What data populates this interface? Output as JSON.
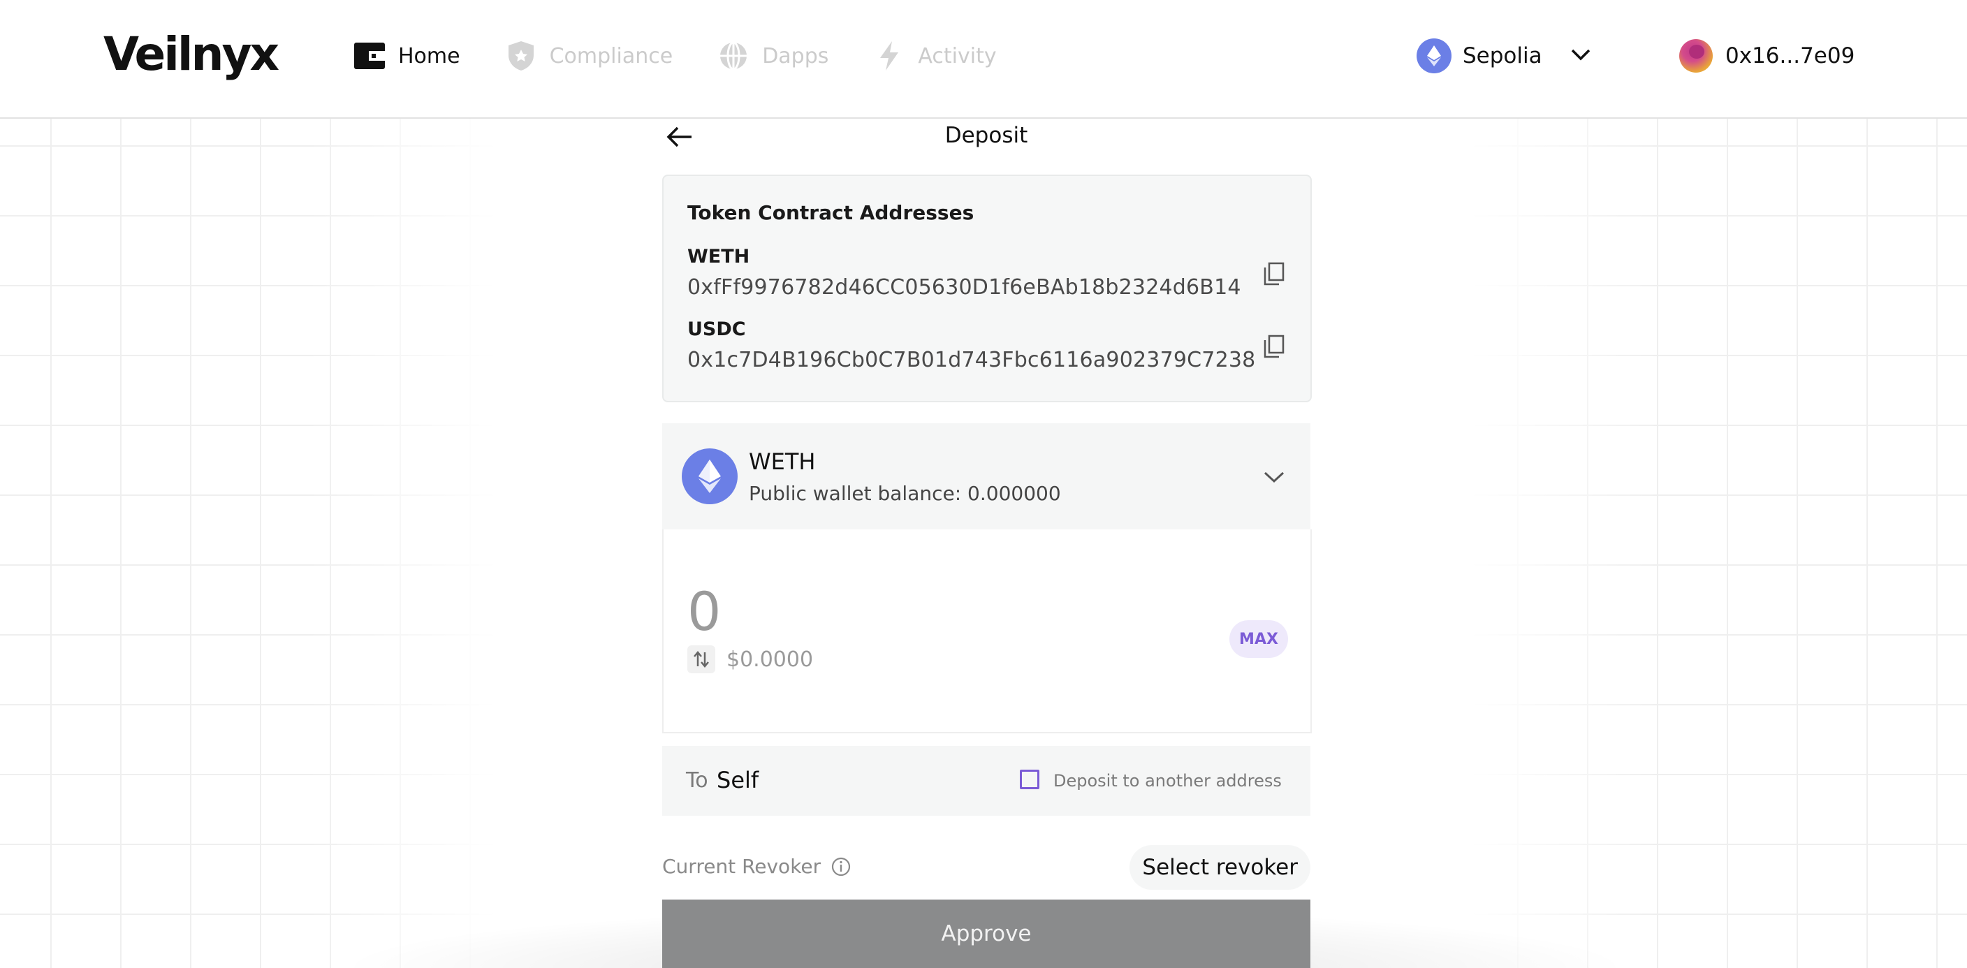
{
  "app": {
    "brand": "Veilnyx"
  },
  "nav": {
    "items": [
      {
        "label": "Home",
        "icon": "wallet-icon",
        "active": true
      },
      {
        "label": "Compliance",
        "icon": "shield-icon",
        "active": false
      },
      {
        "label": "Dapps",
        "icon": "globe-icon",
        "active": false
      },
      {
        "label": "Activity",
        "icon": "lightning-icon",
        "active": false
      }
    ]
  },
  "network": {
    "label": "Sepolia",
    "icon": "ethereum-icon"
  },
  "account": {
    "label": "0x16...7e09"
  },
  "deposit": {
    "title": "Deposit",
    "addresses": {
      "heading": "Token Contract Addresses",
      "items": [
        {
          "symbol": "WETH",
          "address": "0xfFf9976782d46CC05630D1f6eBAb18b2324d6B14"
        },
        {
          "symbol": "USDC",
          "address": "0x1c7D4B196Cb0C7B01d743Fbc6116a902379C7238"
        }
      ]
    },
    "token": {
      "symbol": "WETH",
      "balance_text": "Public wallet balance: 0.000000"
    },
    "amount": {
      "value": "0",
      "usd": "$0.0000",
      "max_label": "MAX"
    },
    "to": {
      "label": "To",
      "value": "Self",
      "checkbox_label": "Deposit to another address",
      "checked": false
    },
    "revoker": {
      "label": "Current Revoker",
      "button_label": "Select revoker"
    },
    "approve_label": "Approve"
  },
  "colors": {
    "accent": "#7b5bd6",
    "eth": "#6b7fe6",
    "approve_bg": "#8a8b8c"
  }
}
